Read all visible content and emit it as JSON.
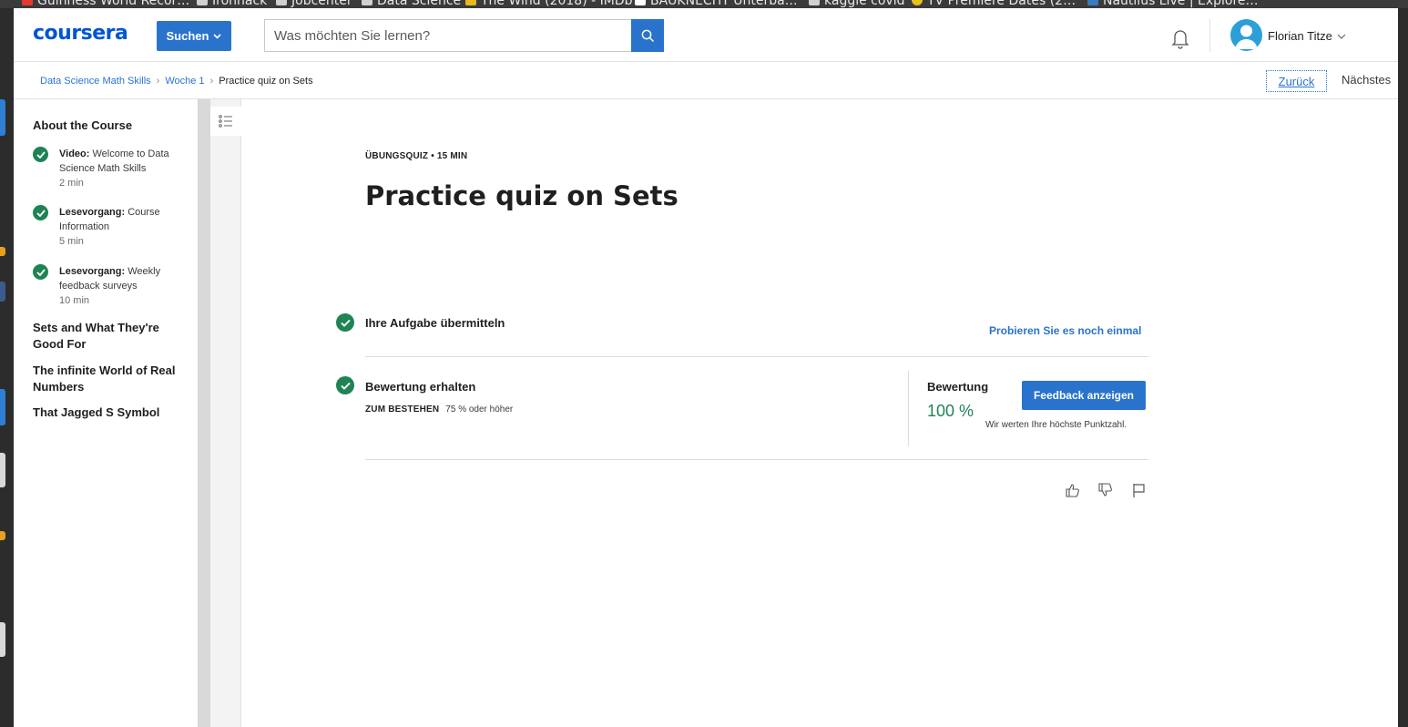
{
  "bookmarks": [
    "Guinness World Recor…",
    "Ironhack",
    "Jobcenter",
    "Data Science",
    "The Wind (2018) - IMDb",
    "BAUKNECHT Unterba…",
    "kaggle covid",
    "TV Premiere Dates (2…",
    "Nautilus Live | Explore…"
  ],
  "header": {
    "logo": "coursera",
    "search_button": "Suchen",
    "search_placeholder": "Was möchten Sie lernen?",
    "user_name": "Florian Titze"
  },
  "breadcrumb": {
    "course": "Data Science Math Skills",
    "week": "Woche 1",
    "current": "Practice quiz on Sets"
  },
  "nav": {
    "back": "Zurück",
    "next": "Nächstes"
  },
  "sidebar": {
    "section_1": "About the Course",
    "items": [
      {
        "type": "Video:",
        "name": "Welcome to Data Science Math Skills",
        "duration": "2 min"
      },
      {
        "type": "Lesevorgang:",
        "name": "Course Information",
        "duration": "5 min"
      },
      {
        "type": "Lesevorgang:",
        "name": "Weekly feedback surveys",
        "duration": "10 min"
      }
    ],
    "section_2": "Sets and What They're Good For",
    "section_3": "The infinite World of Real Numbers",
    "section_4": "That Jagged S Symbol"
  },
  "quiz": {
    "eyebrow": "ÜBUNGSQUIZ • 15 MIN",
    "title": "Practice quiz on Sets",
    "step_submit": "Ihre Aufgabe übermitteln",
    "retry_link": "Probieren Sie es noch einmal",
    "step_grade": "Bewertung erhalten",
    "pass_label": "ZUM BESTEHEN",
    "pass_value": "75 % oder höher",
    "grade_label": "Bewertung",
    "grade_value": "100 %",
    "feedback_button": "Feedback anzeigen",
    "grade_note": "Wir werten Ihre höchste Punktzahl."
  },
  "colors": {
    "brand_blue": "#2a73cc",
    "success_green": "#1f8354"
  }
}
